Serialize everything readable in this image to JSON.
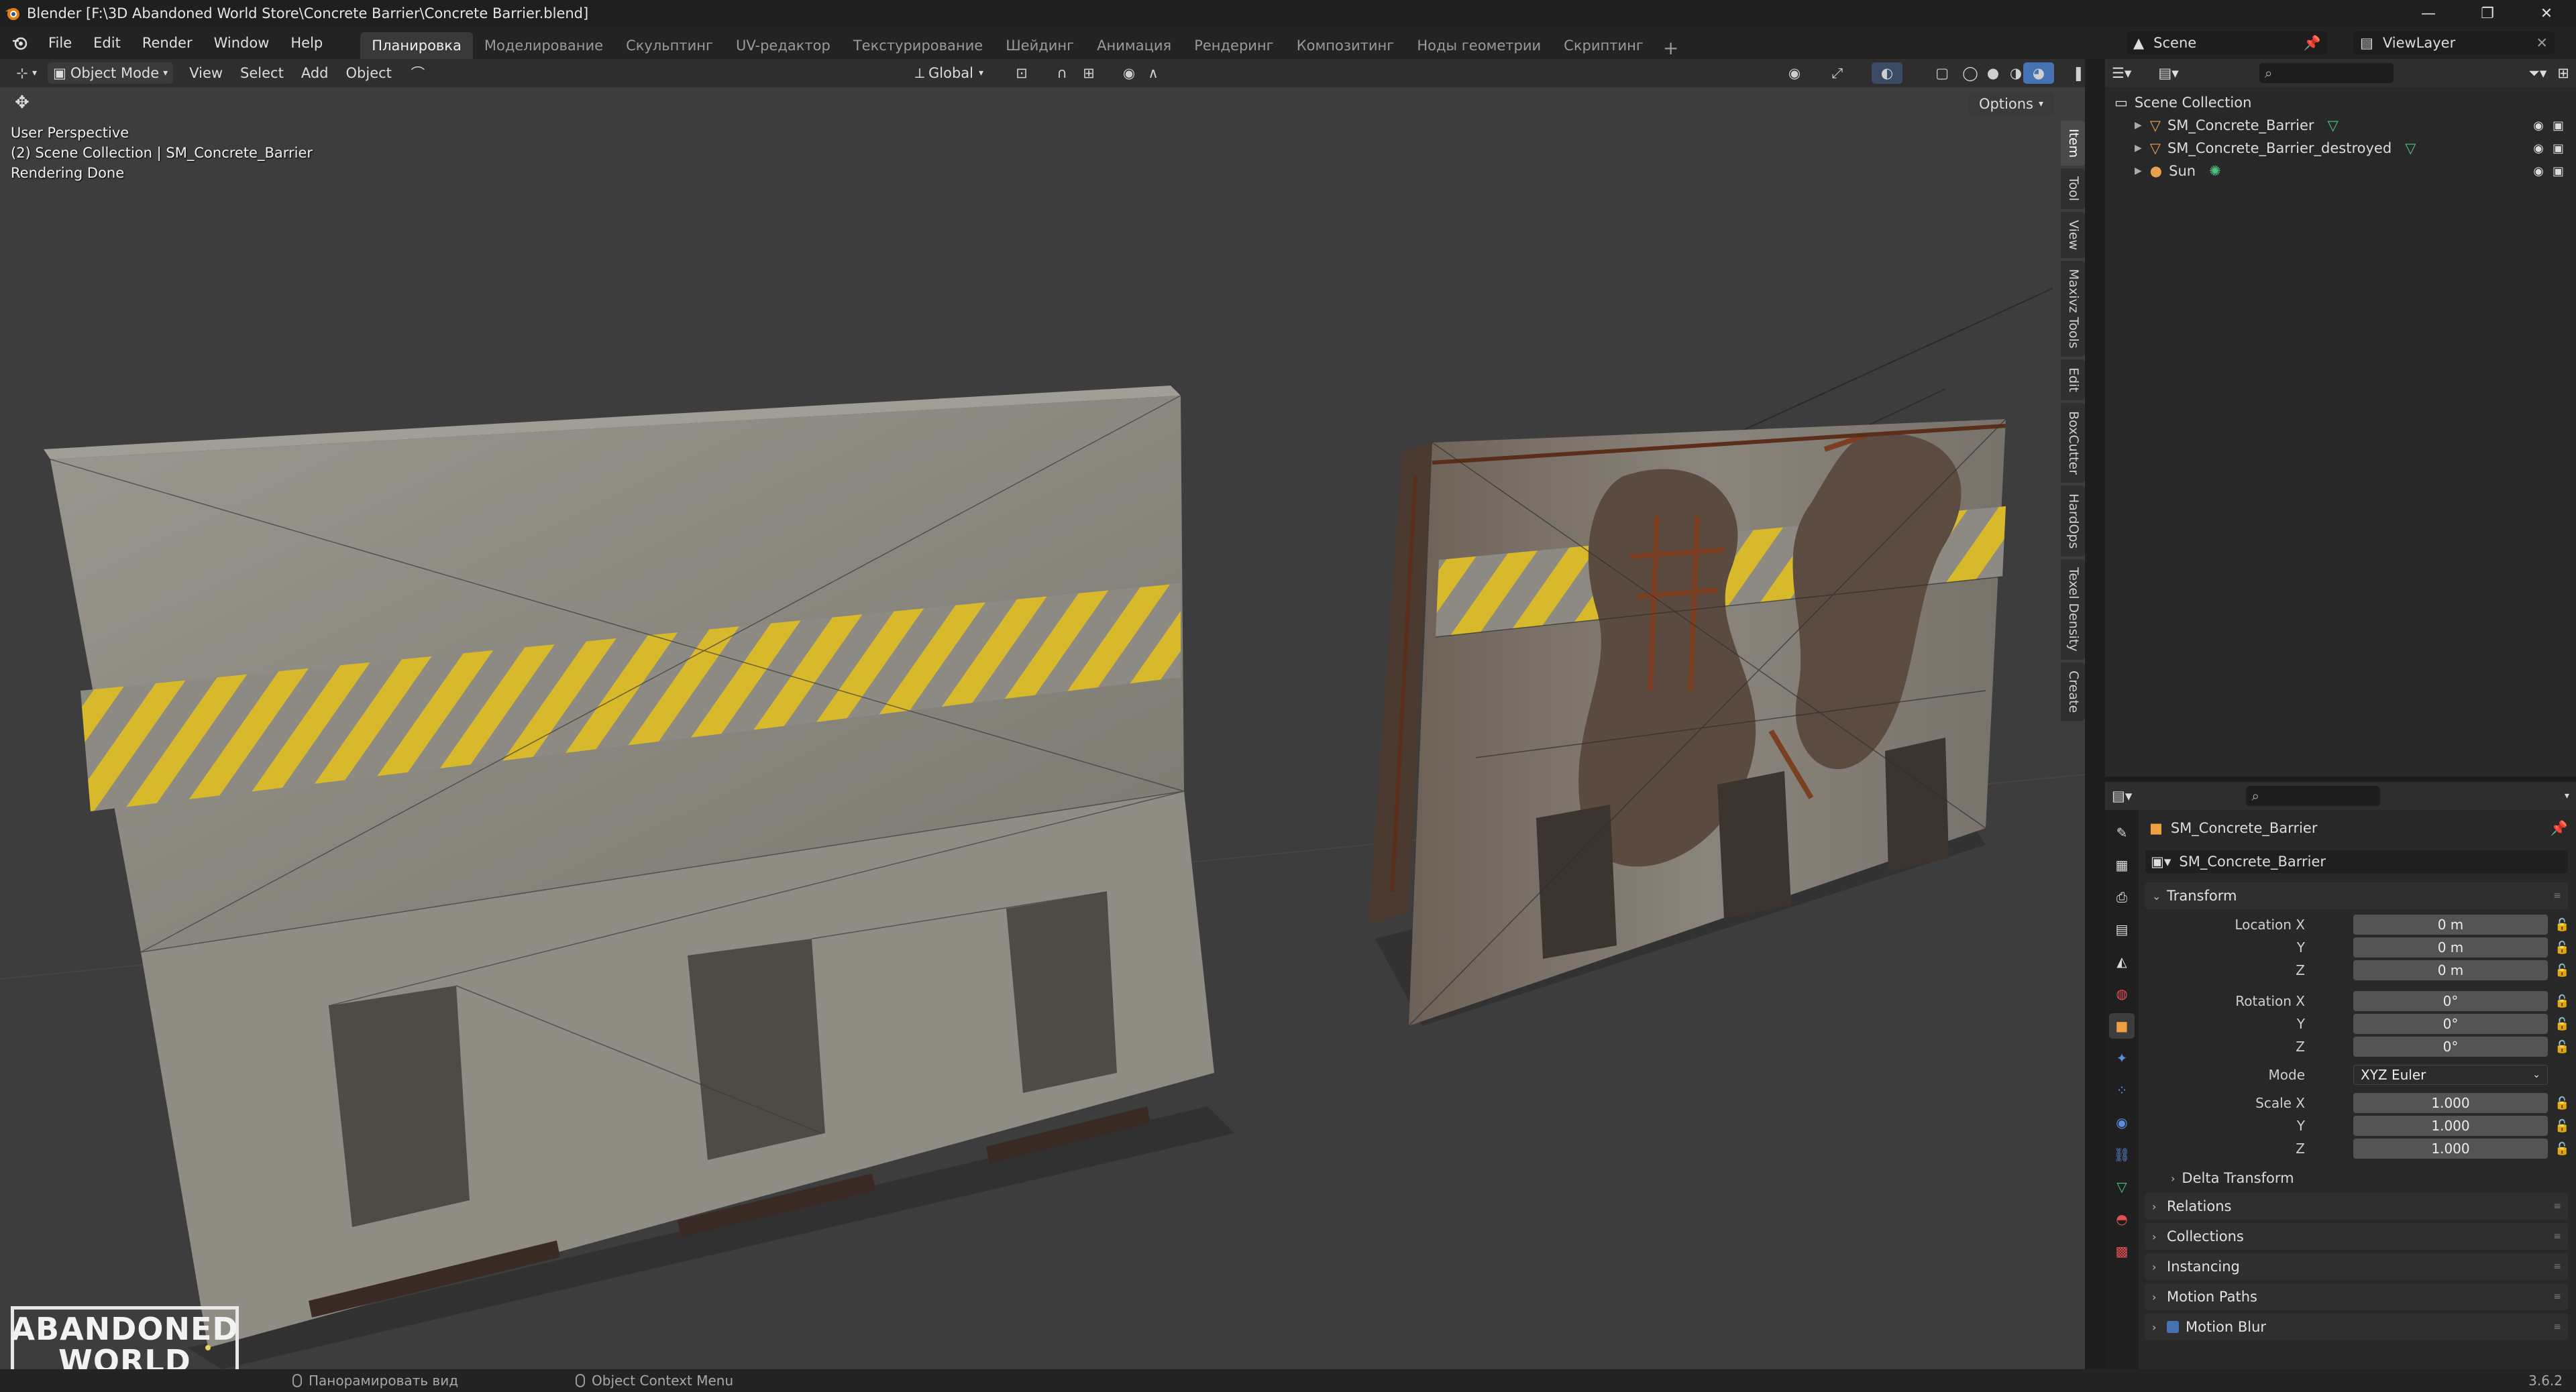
{
  "window": {
    "title": "Blender [F:\\3D Abandoned World Store\\Concrete Barrier\\Concrete Barrier.blend]",
    "minimize": "—",
    "maximize": "❐",
    "close": "✕"
  },
  "menu": {
    "items": [
      "File",
      "Edit",
      "Render",
      "Window",
      "Help"
    ],
    "workspaces": [
      "Планировка",
      "Моделирование",
      "Скульптинг",
      "UV-редактор",
      "Текстурирование",
      "Шейдинг",
      "Анимация",
      "Рендеринг",
      "Композитинг",
      "Ноды геометрии",
      "Скриптинг"
    ],
    "active_workspace": 0,
    "add_workspace": "+",
    "scene": "Scene",
    "view_layer": "ViewLayer"
  },
  "viewport_header": {
    "mode": "Object Mode",
    "menus": [
      "View",
      "Select",
      "Add",
      "Object"
    ],
    "transform_orientation": "Global"
  },
  "viewport": {
    "perspective": "User Perspective",
    "collection_info": "(2) Scene Collection | SM_Concrete_Barrier",
    "status": "Rendering Done",
    "options_label": "Options",
    "side_tabs": [
      "Item",
      "Tool",
      "View",
      "Maxivz Tools",
      "Edit",
      "BoxCutter",
      "HardOps",
      "Texel Density",
      "Create"
    ],
    "watermark_line1": "ABANDONED",
    "watermark_line2": "WORLD",
    "colors": {
      "background": "#3d3d3d",
      "stripe_yellow": "#d9b92c",
      "concrete": "#8d8a82"
    }
  },
  "statusbar": {
    "pan_label": "Панорамировать вид",
    "context_label": "Object Context Menu",
    "version": "3.6.2"
  },
  "outliner": {
    "root": "Scene Collection",
    "items": [
      {
        "name": "SM_Concrete_Barrier",
        "icon": "mesh-icon"
      },
      {
        "name": "SM_Concrete_Barrier_destroyed",
        "icon": "mesh-icon"
      },
      {
        "name": "Sun",
        "icon": "light-icon"
      }
    ]
  },
  "properties": {
    "object_name": "SM_Concrete_Barrier",
    "object_field": "SM_Concrete_Barrier",
    "transform_label": "Transform",
    "location": {
      "label": "Location X",
      "x": "0 m",
      "y": "0 m",
      "z": "0 m"
    },
    "rotation": {
      "label": "Rotation X",
      "x": "0°",
      "y": "0°",
      "z": "0°"
    },
    "mode_label": "Mode",
    "mode_value": "XYZ Euler",
    "scale": {
      "label": "Scale X",
      "x": "1.000",
      "y": "1.000",
      "z": "1.000"
    },
    "axis_y": "Y",
    "axis_z": "Z",
    "delta_transform": "Delta Transform",
    "panels": [
      "Relations",
      "Collections",
      "Instancing",
      "Motion Paths",
      "Motion Blur"
    ]
  }
}
